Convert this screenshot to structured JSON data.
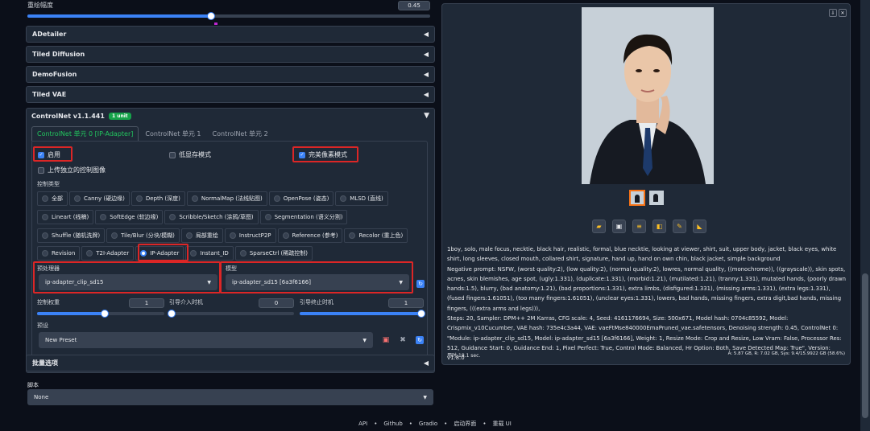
{
  "denoise": {
    "label": "重绘幅度",
    "value": "0.45",
    "fraction": 0.45
  },
  "accordions": [
    {
      "label": "ADetailer"
    },
    {
      "label": "Tiled Diffusion"
    },
    {
      "label": "DemoFusion"
    },
    {
      "label": "Tiled VAE"
    }
  ],
  "controlnet": {
    "title": "ControlNet v1.1.441",
    "badge": "1 unit",
    "tabs": [
      "ControlNet 单元 0 [IP-Adapter]",
      "ControlNet 单元 1",
      "ControlNet 单元 2"
    ],
    "enable": "启用",
    "lowvram": "低显存模式",
    "pixel_perfect": "完美像素模式",
    "upload": "上传独立的控制图像",
    "control_type_label": "控制类型",
    "types_row1": [
      "全部",
      "Canny (硬边缘)",
      "Depth (深度)",
      "NormalMap (法线贴图)",
      "OpenPose (姿态)",
      "MLSD (直线)"
    ],
    "types_row2": [
      "Lineart (线稿)",
      "SoftEdge (软边缘)",
      "Scribble/Sketch (涂鸦/草图)",
      "Segmentation (语义分割)"
    ],
    "types_row3": [
      "Shuffle (随机洗牌)",
      "Tile/Blur (分块/模糊)",
      "局部重绘",
      "InstructP2P",
      "Reference (参考)",
      "Recolor (重上色)"
    ],
    "types_row4": [
      "Revision",
      "T2I-Adapter",
      "IP-Adapter",
      "Instant_ID",
      "SparseCtrl (稀疏控制)"
    ],
    "preprocessor_label": "预处理器",
    "preprocessor_value": "ip-adapter_clip_sd15",
    "model_label": "模型",
    "model_value": "ip-adapter_sd15 [6a3f6166]",
    "weight_label": "控制权重",
    "weight_value": "1",
    "start_label": "引导介入时机",
    "start_value": "0",
    "end_label": "引导终止时机",
    "end_value": "1",
    "preset_label": "预设",
    "preset_value": "New Preset"
  },
  "batch": {
    "label": "批量选项"
  },
  "script": {
    "label": "脚本",
    "value": "None"
  },
  "output": {
    "info_text": "1boy, solo, male focus, necktie, black hair, realistic, formal, blue necktie, looking at viewer, shirt, suit, upper body, jacket, black eyes, white shirt, long sleeves, closed mouth, collared shirt, signature, hand up, hand on own chin, black jacket, simple background",
    "negative": "Negative prompt: NSFW, (worst quality:2), (low quality:2), (normal quality:2), lowres, normal quality, ((monochrome)), ((grayscale)), skin spots, acnes, skin blemishes, age spot, (ugly:1.331), (duplicate:1.331), (morbid:1.21), (mutilated:1.21), (tranny:1.331), mutated hands, (poorly drawn hands:1.5), blurry, (bad anatomy:1.21), (bad proportions:1.331), extra limbs, (disfigured:1.331), (missing arms:1.331), (extra legs:1.331), (fused fingers:1.61051), (too many fingers:1.61051), (unclear eyes:1.331), lowers, bad hands, missing fingers, extra digit,bad hands, missing fingers, (((extra arms and legs))),",
    "params": "Steps: 20, Sampler: DPM++ 2M Karras, CFG scale: 4, Seed: 4161176694, Size: 500x671, Model hash: 0704c85592, Model: Crispmix_v10Cucumber, VAE hash: 735e4c3a44, VAE: vaeFtMse840000EmaPruned_vae.safetensors, Denoising strength: 0.45, ControlNet 0: \"Module: ip-adapter_clip_sd15, Model: ip-adapter_sd15 [6a3f6166], Weight: 1, Resize Mode: Crop and Resize, Low Vram: False, Processor Res: 512, Guidance Start: 0, Guidance End: 1, Pixel Perfect: True, Control Mode: Balanced, Hr Option: Both, Save Detected Map: True\", Version: v1.8.0",
    "time": "用时:18.1 sec.",
    "vram": "A: 5.87 GB, R: 7.02 GB, Sys: 9.4/15.9922 GB (58.6%)"
  },
  "footer": [
    "API",
    "Github",
    "Gradio",
    "启动界面",
    "重载 UI"
  ]
}
